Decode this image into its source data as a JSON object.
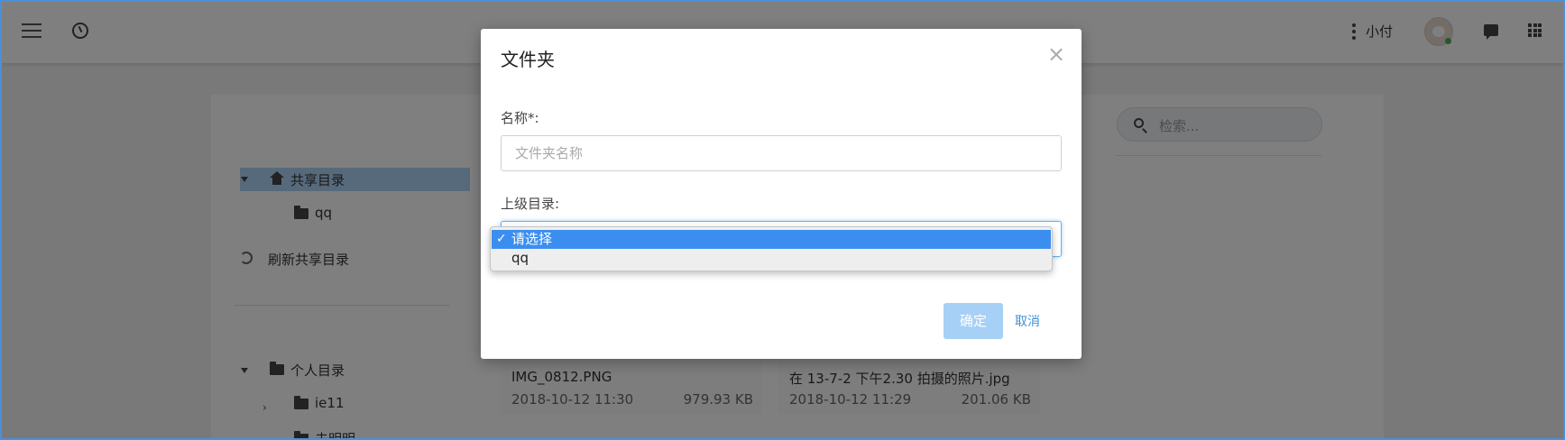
{
  "header": {
    "user_name": "小付"
  },
  "sidebar": {
    "shared_root": "共享目录",
    "shared_children": [
      "qq"
    ],
    "refresh_label": "刷新共享目录",
    "personal_root": "个人目录",
    "personal_children": [
      "ie11",
      "未明明"
    ]
  },
  "search": {
    "placeholder": "检索..."
  },
  "files": [
    {
      "name": "IMG_0812.PNG",
      "date": "2018-10-12 11:30",
      "size": "979.93 KB"
    },
    {
      "name": "在 13-7-2 下午2.30 拍摄的照片.jpg",
      "date": "2018-10-12 11:29",
      "size": "201.06 KB"
    }
  ],
  "modal": {
    "title": "文件夹",
    "close_glyph": "×",
    "name_label": "名称*:",
    "name_placeholder": "文件夹名称",
    "name_value": "",
    "parent_label": "上级目录:",
    "parent_options": [
      "请选择",
      "qq"
    ],
    "parent_selected": "请选择",
    "check_glyph": "✓",
    "ok_label": "确定",
    "cancel_label": "取消"
  },
  "colors": {
    "accent": "#3b8ef0",
    "ok_button": "#a6d0f5",
    "link": "#3f8fd9",
    "tree_selection": "#aed5f7"
  }
}
